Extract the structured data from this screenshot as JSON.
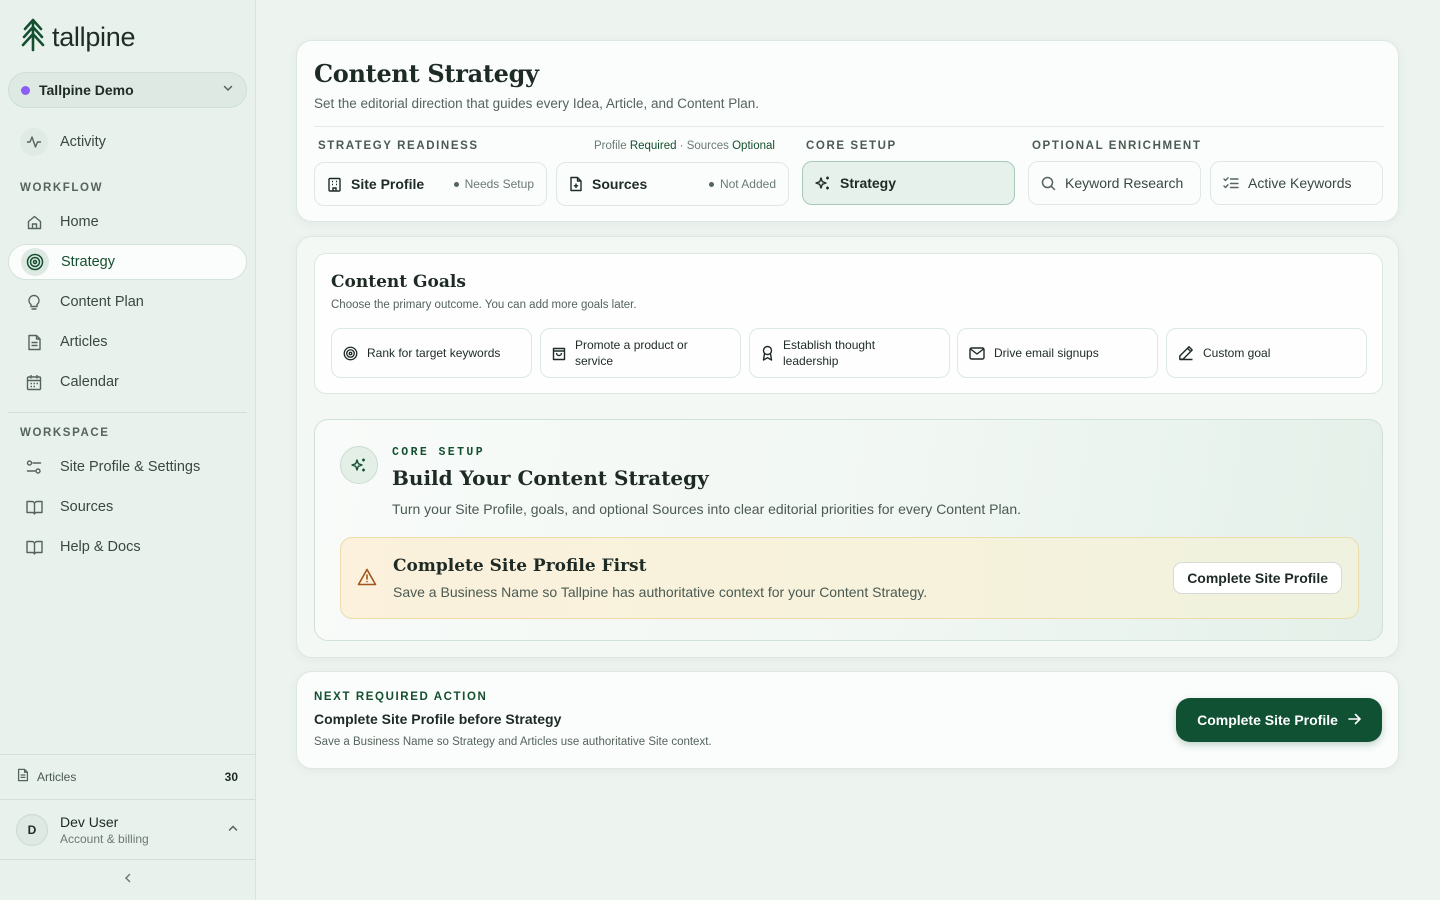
{
  "brand": {
    "name": "tallpine",
    "accent": "#0f5132"
  },
  "workspace": {
    "name": "Tallpine Demo",
    "dot_color": "#8b5cf6"
  },
  "sidebar": {
    "activity": "Activity",
    "workflow_label": "WORKFLOW",
    "workflow_items": [
      {
        "label": "Home",
        "icon": "home-icon"
      },
      {
        "label": "Strategy",
        "icon": "target-icon",
        "active": true
      },
      {
        "label": "Content Plan",
        "icon": "lightbulb-icon"
      },
      {
        "label": "Articles",
        "icon": "document-icon"
      },
      {
        "label": "Calendar",
        "icon": "calendar-icon"
      }
    ],
    "workspace_label": "WORKSPACE",
    "workspace_items": [
      {
        "label": "Site Profile & Settings",
        "icon": "settings-sliders-icon"
      },
      {
        "label": "Sources",
        "icon": "book-icon"
      },
      {
        "label": "Help & Docs",
        "icon": "book-icon"
      }
    ],
    "footer": {
      "articles_label": "Articles",
      "articles_count": "30"
    },
    "user": {
      "initial": "D",
      "name": "Dev User",
      "sub": "Account & billing"
    }
  },
  "header": {
    "title": "Content Strategy",
    "subtitle": "Set the editorial direction that guides every Idea, Article, and Content Plan.",
    "readiness_label": "STRATEGY READINESS",
    "note_profile": "Profile",
    "note_required": "Required",
    "note_sep": " · ",
    "note_sources": "Sources",
    "note_optional": "Optional",
    "core_label": "CORE SETUP",
    "optional_label": "OPTIONAL ENRICHMENT",
    "chips": {
      "site_profile": {
        "label": "Site Profile",
        "status": "Needs Setup"
      },
      "sources": {
        "label": "Sources",
        "status": "Not Added"
      },
      "strategy": {
        "label": "Strategy"
      },
      "keyword_research": {
        "label": "Keyword Research"
      },
      "active_keywords": {
        "label": "Active Keywords"
      }
    }
  },
  "goals": {
    "title": "Content Goals",
    "subtitle": "Choose the primary outcome. You can add more goals later.",
    "items": [
      {
        "label": "Rank for target keywords",
        "icon": "target-icon"
      },
      {
        "label": "Promote a product or service",
        "icon": "shopping-bag-icon"
      },
      {
        "label": "Establish thought leadership",
        "icon": "award-icon"
      },
      {
        "label": "Drive email signups",
        "icon": "mail-icon"
      },
      {
        "label": "Custom goal",
        "icon": "pencil-icon"
      }
    ]
  },
  "core": {
    "caption": "CORE SETUP",
    "title": "Build Your Content Strategy",
    "subtitle": "Turn your Site Profile, goals, and optional Sources into clear editorial priorities for every Content Plan.",
    "warning": {
      "title": "Complete Site Profile First",
      "text": "Save a Business Name so Tallpine has authoritative context for your Content Strategy.",
      "button": "Complete Site Profile"
    }
  },
  "next_action": {
    "caption": "NEXT REQUIRED ACTION",
    "title": "Complete Site Profile before Strategy",
    "text": "Save a Business Name so Strategy and Articles use authoritative Site context.",
    "button": "Complete Site Profile"
  }
}
